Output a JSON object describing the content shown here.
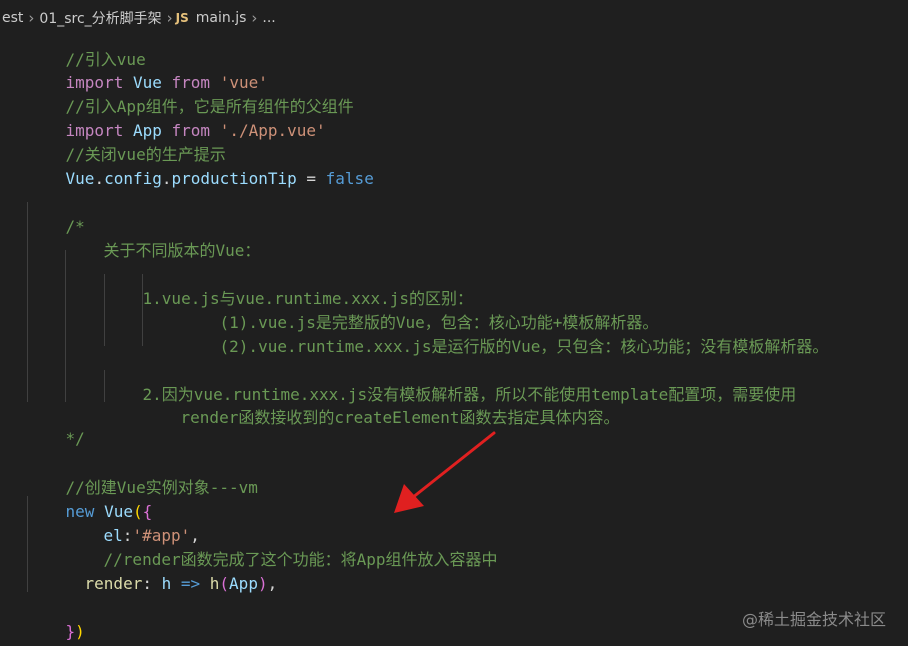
{
  "breadcrumb": {
    "items": [
      "est",
      "01_src_分析脚手架",
      "main.js",
      "..."
    ],
    "js_badge": "JS"
  },
  "code": {
    "l1_comment": "//引入vue",
    "l2_import": "import",
    "l2_name": "Vue",
    "l2_from": "from",
    "l2_str": "'vue'",
    "l3_comment": "//引入App组件，它是所有组件的父组件",
    "l4_import": "import",
    "l4_name": "App",
    "l4_from": "from",
    "l4_str": "'./App.vue'",
    "l5_comment": "//关闭vue的生产提示",
    "l6_vue": "Vue",
    "l6_config": "config",
    "l6_prop": "productionTip",
    "l6_eq": " = ",
    "l6_false": "false",
    "c_open": "/*",
    "c_l1": "关于不同版本的Vue：",
    "c_l2": "1.vue.js与vue.runtime.xxx.js的区别：",
    "c_l3": "(1).vue.js是完整版的Vue，包含：核心功能+模板解析器。",
    "c_l4": "(2).vue.runtime.xxx.js是运行版的Vue，只包含：核心功能；没有模板解析器。",
    "c_l5": "2.因为vue.runtime.xxx.js没有模板解析器，所以不能使用template配置项，需要使用",
    "c_l6": "render函数接收到的createElement函数去指定具体内容。",
    "c_close": "*/",
    "vm_comment": "//创建Vue实例对象---vm",
    "new_kw": "new",
    "new_vue": "Vue",
    "el_key": "el",
    "el_val": "'#app'",
    "render_comment": "//render函数完成了这个功能：将App组件放入容器中",
    "render_key": "render",
    "render_h": "h",
    "render_arrow": " => ",
    "render_fn": "h",
    "render_arg": "App"
  },
  "watermark": "@稀土掘金技术社区",
  "colors": {
    "background": "#1f1f1f",
    "keyword": "#c586c0",
    "identifier": "#9cdcfe",
    "string": "#ce9178",
    "comment": "#6a9955",
    "arrow_annotation": "#e02020"
  }
}
